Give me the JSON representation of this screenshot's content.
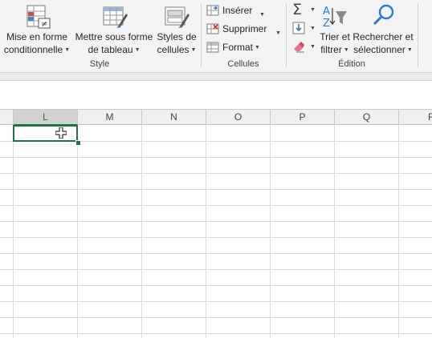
{
  "ribbon": {
    "style_group": {
      "label": "Style",
      "conditional_format": {
        "line1": "Mise en forme",
        "line2": "conditionnelle"
      },
      "format_as_table": {
        "line1": "Mettre sous forme",
        "line2": "de tableau"
      },
      "cell_styles": {
        "line1": "Styles de",
        "line2": "cellules"
      }
    },
    "cells_group": {
      "label": "Cellules",
      "insert": "Insérer",
      "delete": "Supprimer",
      "format": "Format"
    },
    "editing_group": {
      "label": "Édition",
      "sort_filter": {
        "line1": "Trier et",
        "line2": "filtrer"
      },
      "find_select": {
        "line1": "Rechercher et",
        "line2": "sélectionner"
      }
    }
  },
  "sheet": {
    "columns": [
      "L",
      "M",
      "N",
      "O",
      "P",
      "Q",
      "R"
    ],
    "selected_column": "L",
    "active_cell": "L"
  },
  "colors": {
    "accent": "#217346",
    "ribbon_bg": "#f3f3f3",
    "gridline": "#dadada"
  }
}
